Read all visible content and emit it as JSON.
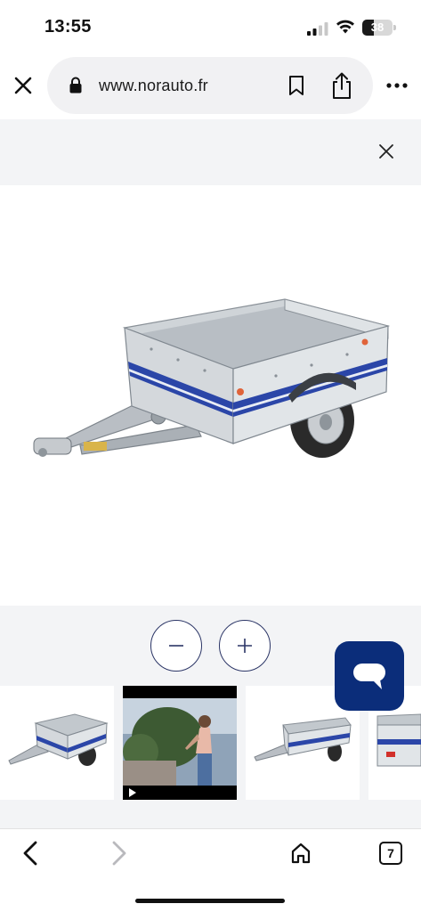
{
  "status_bar": {
    "time": "13:55",
    "battery_percent": "38",
    "battery_level": 0.38
  },
  "browser": {
    "url": "www.norauto.fr",
    "tab_count": "7"
  },
  "viewer": {
    "zoom_out_symbol": "−",
    "zoom_in_symbol": "+"
  },
  "thumbnails": [
    {
      "kind": "image",
      "icon": "trailer-icon"
    },
    {
      "kind": "video",
      "icon": "play-icon"
    },
    {
      "kind": "image",
      "icon": "trailer-icon"
    },
    {
      "kind": "image",
      "icon": "trailer-icon"
    }
  ],
  "colors": {
    "brand_navy": "#0b2d7a",
    "trailer_stripe": "#2b46a8",
    "panel_bg": "#f3f4f6"
  }
}
